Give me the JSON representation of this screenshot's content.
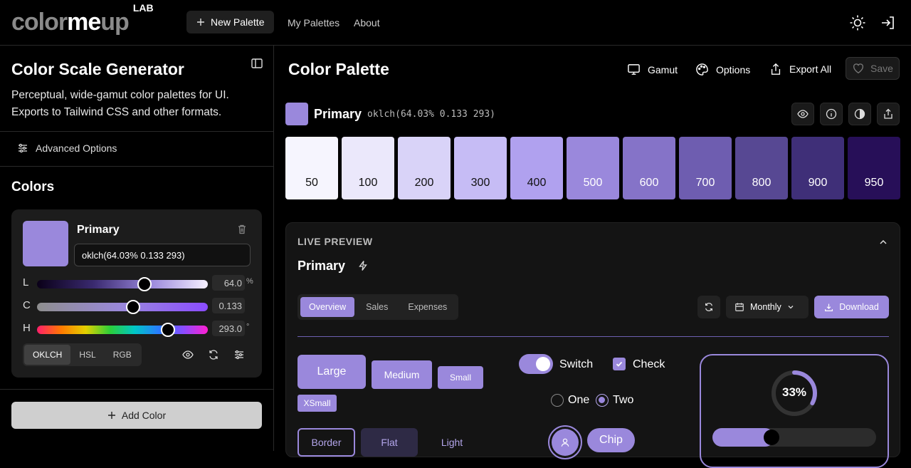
{
  "brand": {
    "logo_a": "color",
    "logo_b": "me",
    "logo_c": "up",
    "logo_lab": "LAB"
  },
  "nav": {
    "new_palette": "New Palette",
    "my_palettes": "My Palettes",
    "about": "About"
  },
  "sidebar": {
    "title": "Color Scale Generator",
    "description": "Perceptual, wide-gamut color palettes for UI. Exports to Tailwind CSS and other formats.",
    "advanced_options": "Advanced Options",
    "colors_heading": "Colors",
    "card": {
      "name": "Primary",
      "value": "oklch(64.03% 0.133 293)",
      "sliders": [
        {
          "label": "L",
          "value": "64.0",
          "unit": "%",
          "position": 0.64
        },
        {
          "label": "C",
          "value": "0.133",
          "unit": "",
          "position": 0.57
        },
        {
          "label": "H",
          "value": "293.0",
          "unit": "°",
          "position": 0.79
        }
      ],
      "modes": [
        "OKLCH",
        "HSL",
        "RGB"
      ],
      "active_mode": "OKLCH"
    },
    "add_color": "Add Color"
  },
  "main": {
    "title": "Color Palette",
    "toolbar": {
      "gamut": "Gamut",
      "options": "Options",
      "export_all": "Export All",
      "save": "Save"
    },
    "palette": {
      "name": "Primary",
      "value": "oklch(64.03% 0.133 293)",
      "swatches": [
        {
          "label": "50",
          "color": "#f6f5fe",
          "text": "#111111"
        },
        {
          "label": "100",
          "color": "#ebe8fb",
          "text": "#111111"
        },
        {
          "label": "200",
          "color": "#d9d3f8",
          "text": "#111111"
        },
        {
          "label": "300",
          "color": "#c6bcf5",
          "text": "#111111"
        },
        {
          "label": "400",
          "color": "#b0a1ef",
          "text": "#111111"
        },
        {
          "label": "500",
          "color": "#9a88dc",
          "text": "#ffffff"
        },
        {
          "label": "600",
          "color": "#8573c8",
          "text": "#ffffff"
        },
        {
          "label": "700",
          "color": "#6e5db0",
          "text": "#ffffff"
        },
        {
          "label": "800",
          "color": "#574893",
          "text": "#ffffff"
        },
        {
          "label": "900",
          "color": "#3f2f78",
          "text": "#ffffff"
        },
        {
          "label": "950",
          "color": "#270f58",
          "text": "#ffffff"
        }
      ]
    },
    "preview": {
      "heading": "LIVE PREVIEW",
      "title": "Primary",
      "tabs": [
        "Overview",
        "Sales",
        "Expenses"
      ],
      "active_tab": "Overview",
      "period": "Monthly",
      "download": "Download",
      "buttons": {
        "large": "Large",
        "medium": "Medium",
        "small": "Small",
        "xsmall": "XSmall",
        "border": "Border",
        "flat": "Flat",
        "light": "Light"
      },
      "switch_label": "Switch",
      "check_label": "Check",
      "radio_one": "One",
      "radio_two": "Two",
      "chip": "Chip",
      "progress_text": "33%",
      "progress": 0.33,
      "slider_progress": 0.35
    }
  },
  "colors": {
    "accent": "#9a88dc",
    "accent_light": "#b3a5ea",
    "background": "#000000",
    "panel": "#141414"
  }
}
